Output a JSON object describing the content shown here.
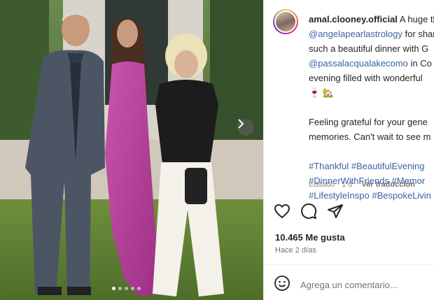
{
  "post": {
    "username": "amal.clooney.official",
    "caption_lines": [
      "A huge thank you to",
      "for sharing",
      "such a beautiful dinner with G",
      "in Co",
      "evening filled with wonderful",
      "Feeling grateful for your gene",
      "memories. Can't wait to see m"
    ],
    "mentions": [
      "@angelapearlastrology",
      "@passalacqualakecomo"
    ],
    "emoji_line": "🍷 🏡",
    "hashtags": [
      "#Thankful",
      "#BeautifulEvening",
      "#DinnerWithFriends",
      "#Memor",
      "#LifestyleInspo",
      "#BespokeLivin"
    ],
    "edited_label": "Editado · 1 d",
    "translate_label": "Ver traducción"
  },
  "likes_label": "10.465 Me gusta",
  "time_label": "Hace 2 días",
  "comment": {
    "placeholder": "Agrega un comentario..."
  },
  "carousel": {
    "dots": 5,
    "active_index": 0
  },
  "icons": {
    "like": "heart-icon",
    "comment": "comment-bubble-icon",
    "share": "paper-plane-icon",
    "emoji": "smiley-icon",
    "next": "chevron-right-icon"
  },
  "colors": {
    "link": "#3a62a8",
    "dress": "#b8409a",
    "grass": "#5b7a34"
  }
}
